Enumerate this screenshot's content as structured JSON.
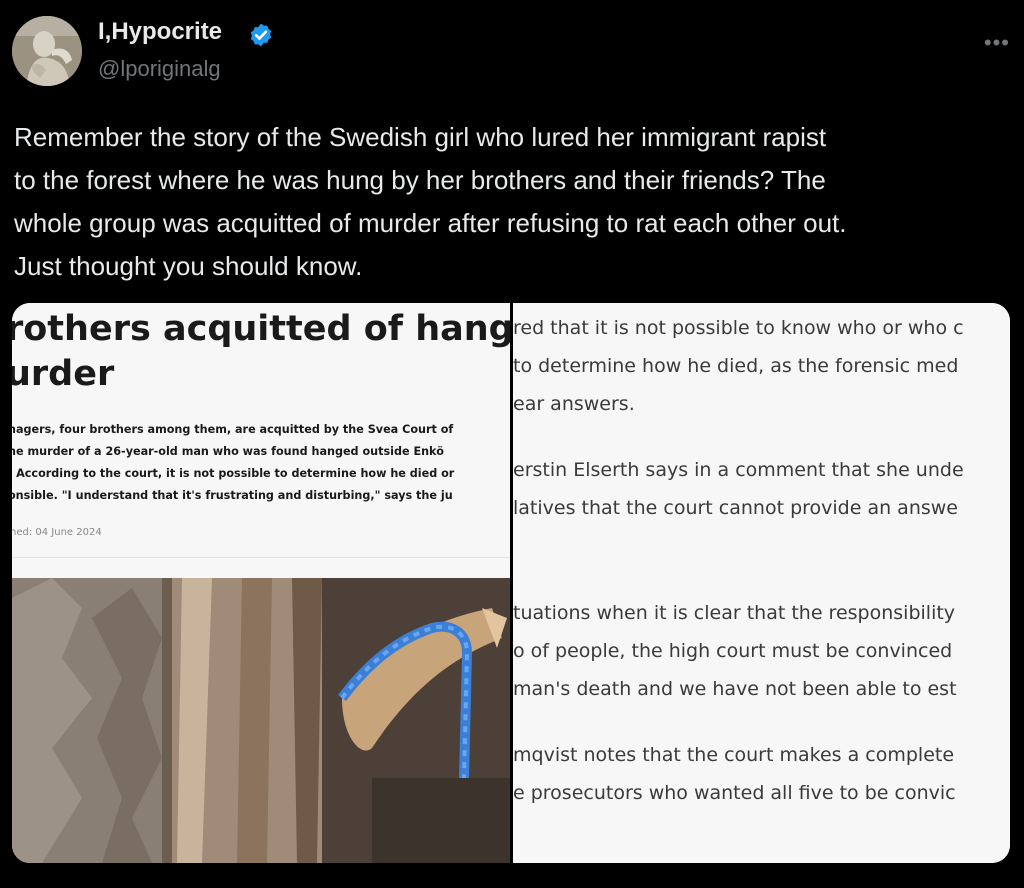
{
  "author": {
    "display_name": "I,Hypocrite",
    "handle": "@lporiginalg",
    "verified": true,
    "avatar_icon": "avatar-statue"
  },
  "more_label": "•••",
  "tweet": {
    "lines": [
      "Remember the story of the Swedish girl who lured her immigrant rapist",
      "to the forest where he was hung by her brothers and their friends? The",
      "whole group was acquitted of murder after refusing to rat each other out.",
      "Just thought you should know."
    ]
  },
  "article": {
    "headline_lines": [
      "rothers acquitted of hangi",
      "urder"
    ],
    "lede_lines": [
      "nagers, four brothers among them, are acquitted by the Svea Court of",
      "he murder of a 26-year-old man who was found hanged outside Enkö",
      ". According to the court, it is not possible to determine how he died or",
      "onsible. \"I understand that it's frustrating and disturbing,\" says the ju"
    ],
    "published": "hed: 04 June 2024",
    "photo_icon": "tree-rope-photo"
  },
  "article_continued": {
    "lines": [
      "red that it is not possible to know who or who c",
      "to determine how he died, as the forensic med",
      "ear answers.",
      "erstin Elserth says in a comment that she unde",
      "latives that the court cannot provide an answe",
      "tuations when it is clear that the responsibility",
      "o of people, the high court must be convinced",
      "man's death and we have not been able to est",
      "mqvist notes that the court makes a complete",
      "e prosecutors who wanted all five to be convic"
    ]
  },
  "colors": {
    "background": "#000000",
    "text": "#e7e9ea",
    "secondary": "#71767b",
    "verified": "#1d9bf0"
  }
}
